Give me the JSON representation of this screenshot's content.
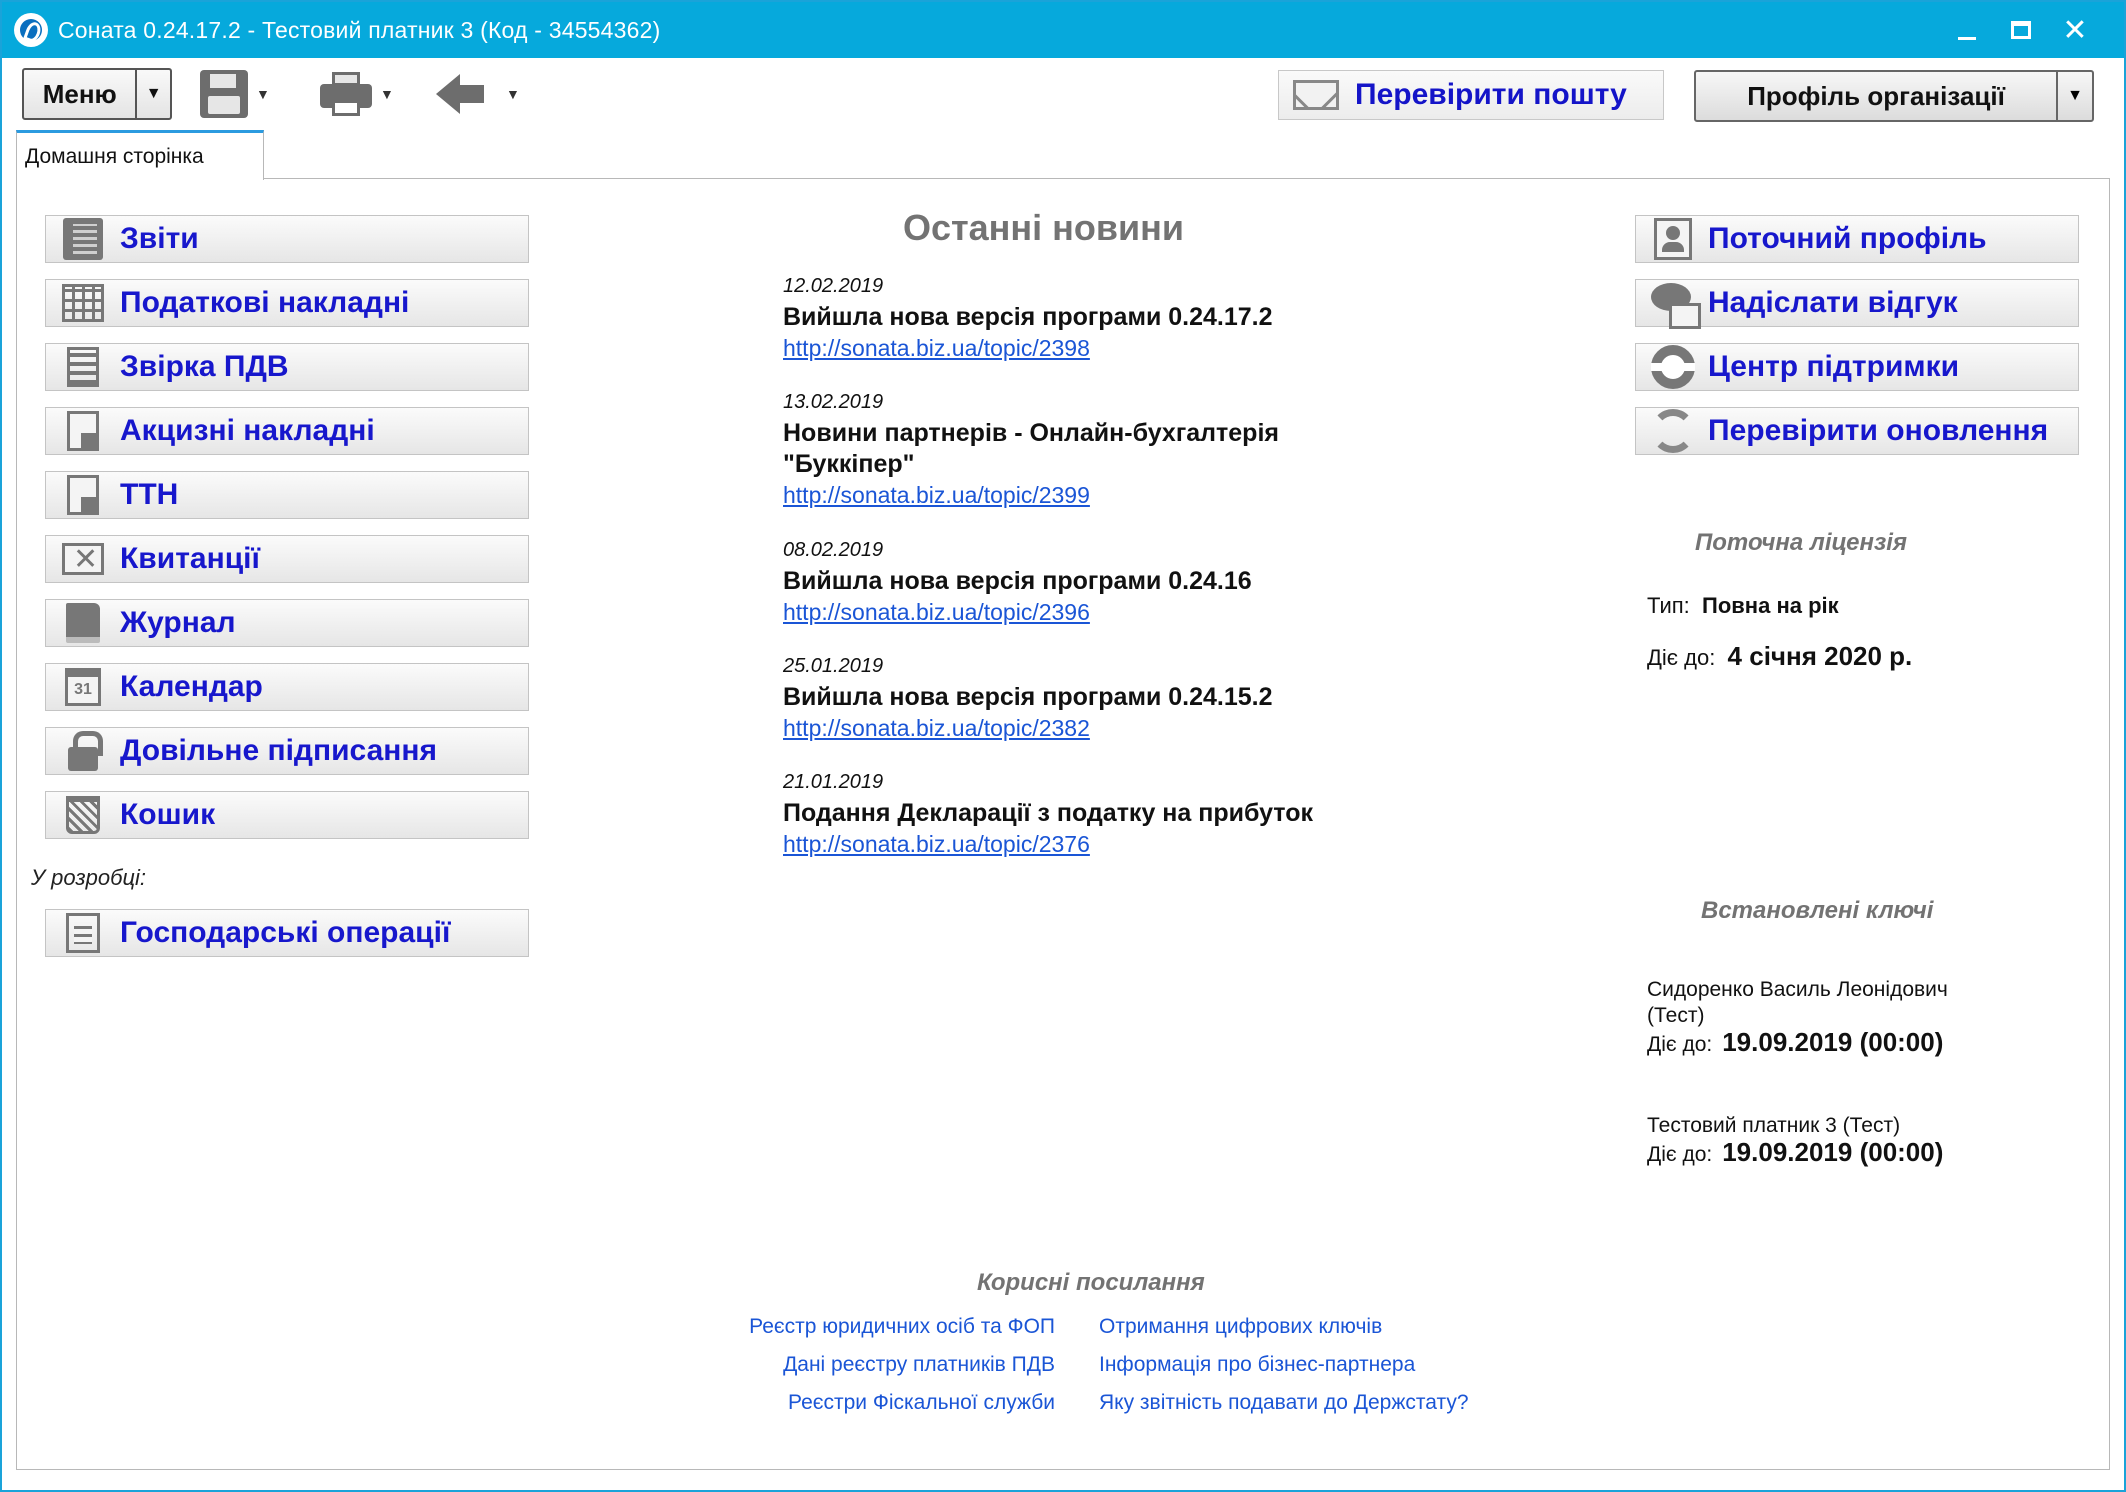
{
  "window": {
    "title": "Соната 0.24.17.2 - Тестовий платник 3 (Код - 34554362)",
    "controls": {
      "minimize": "",
      "maximize": "",
      "close": "✕"
    }
  },
  "toolbar": {
    "menu_label": "Меню",
    "menu_arrow": "▼",
    "dropdown_arrow": "▼",
    "check_mail_label": "Перевірити пошту",
    "org_profile_label": "Профіль організації",
    "org_profile_arrow": "▼",
    "icons": [
      "save-icon",
      "print-icon",
      "back-arrow-icon",
      "mail-icon"
    ]
  },
  "tabs": [
    {
      "label": "Домашня сторінка",
      "active": true
    }
  ],
  "left_nav": {
    "items": [
      {
        "label": "Звіти",
        "icon": "reports-icon"
      },
      {
        "label": "Податкові накладні",
        "icon": "grid-icon"
      },
      {
        "label": "Звірка ПДВ",
        "icon": "calculator-icon"
      },
      {
        "label": "Акцизні накладні",
        "icon": "document-icon"
      },
      {
        "label": "ТТН",
        "icon": "truck-document-icon"
      },
      {
        "label": "Квитанції",
        "icon": "envelope-icon"
      },
      {
        "label": "Журнал",
        "icon": "book-icon"
      },
      {
        "label": "Календар",
        "icon": "calendar-icon"
      },
      {
        "label": "Довільне підписання",
        "icon": "lock-icon"
      },
      {
        "label": "Кошик",
        "icon": "trash-icon"
      }
    ],
    "calendar_icon_text": "31",
    "in_development_label": "У розробці:",
    "dev_items": [
      {
        "label": "Господарські операції",
        "icon": "list-icon"
      }
    ]
  },
  "news": {
    "title": "Останні новини",
    "items": [
      {
        "date": "12.02.2019",
        "headline": "Вийшла нова версія програми 0.24.17.2",
        "link": "http://sonata.biz.ua/topic/2398"
      },
      {
        "date": "13.02.2019",
        "headline": "Новини партнерів - Онлайн-бухгалтерія \"Буккіпер\"",
        "link": "http://sonata.biz.ua/topic/2399"
      },
      {
        "date": "08.02.2019",
        "headline": "Вийшла нова версія програми 0.24.16",
        "link": "http://sonata.biz.ua/topic/2396"
      },
      {
        "date": "25.01.2019",
        "headline": "Вийшла нова версія програми 0.24.15.2",
        "link": "http://sonata.biz.ua/topic/2382"
      },
      {
        "date": "21.01.2019",
        "headline": "Подання Декларації з податку на прибуток",
        "link": "http://sonata.biz.ua/topic/2376"
      }
    ]
  },
  "right_panel": {
    "buttons": [
      {
        "label": "Поточний профіль",
        "icon": "profile-icon"
      },
      {
        "label": "Надіслати відгук",
        "icon": "feedback-icon"
      },
      {
        "label": "Центр підтримки",
        "icon": "support-icon"
      },
      {
        "label": "Перевірити оновлення",
        "icon": "refresh-icon"
      }
    ],
    "license": {
      "title": "Поточна ліцензія",
      "type_label": "Тип:",
      "type_value": "Повна на рік",
      "until_label": "Діє до:",
      "until_value": "4 січня 2020 р."
    },
    "keys": {
      "title": "Встановлені ключі",
      "items": [
        {
          "owner": "Сидоренко Василь Леонідович (Тест)",
          "until_label": "Діє до:",
          "until_value": "19.09.2019 (00:00)"
        },
        {
          "owner": "Тестовий платник 3 (Тест)",
          "until_label": "Діє до:",
          "until_value": "19.09.2019 (00:00)"
        }
      ]
    }
  },
  "useful_links": {
    "title": "Корисні посилання",
    "left": [
      "Реєстр юридичних осіб та ФОП",
      "Дані реєстру платників ПДВ",
      "Реєстри Фіскальної служби"
    ],
    "right": [
      "Отримання цифрових ключів",
      "Інформація про бізнес-партнера",
      "Яку звітність подавати до Держстату?"
    ]
  },
  "colors": {
    "titlebar": "#06a9dc",
    "nav_text": "#1717cc",
    "link": "#1a55d6",
    "section_title": "#737373"
  }
}
